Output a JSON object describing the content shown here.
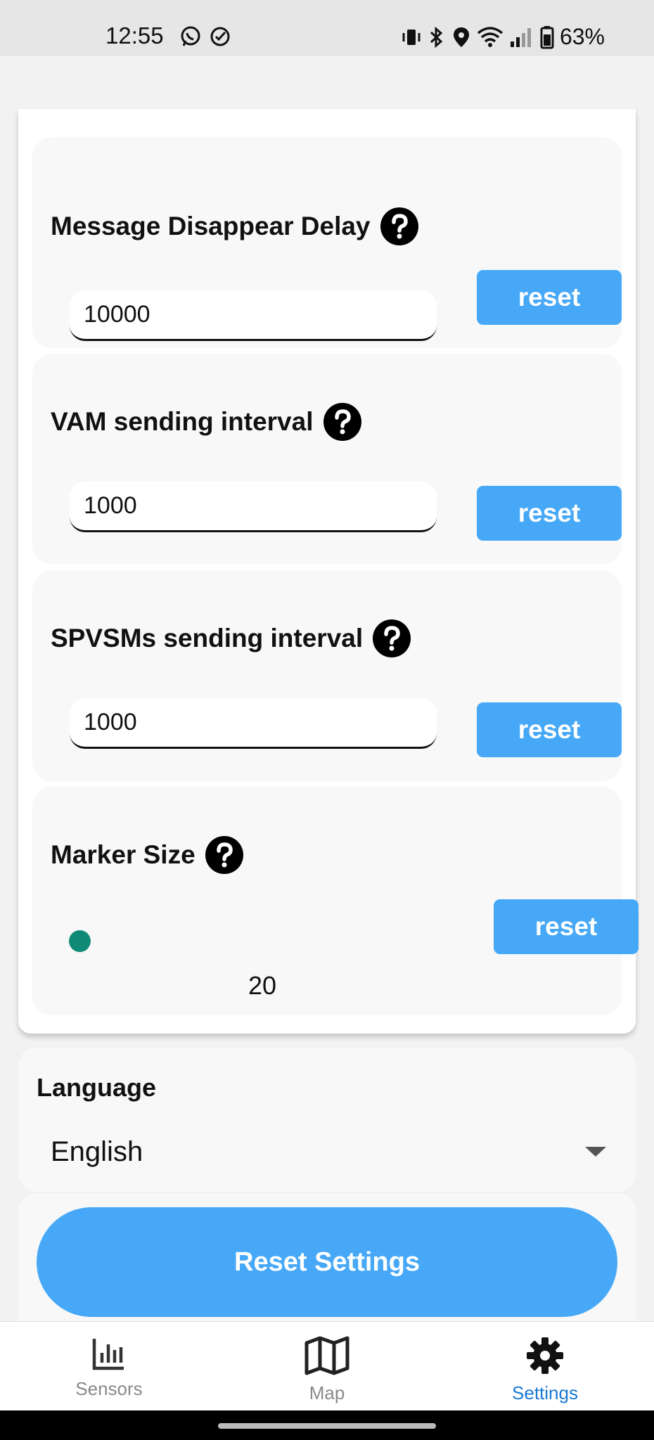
{
  "status_bar": {
    "time": "12:55",
    "battery": "63%",
    "icons": [
      "whatsapp-icon",
      "check-circle-icon",
      "vibrate-icon",
      "bluetooth-icon",
      "location-icon",
      "wifi-icon",
      "signal-icon",
      "battery-icon"
    ]
  },
  "settings": [
    {
      "label": "Message Disappear Delay",
      "value": "10000",
      "reset_label": "reset"
    },
    {
      "label": "VAM sending interval",
      "value": "1000",
      "reset_label": "reset"
    },
    {
      "label": "SPVSMs sending interval",
      "value": "1000",
      "reset_label": "reset"
    }
  ],
  "marker_size": {
    "label": "Marker Size",
    "value": "20",
    "reset_label": "reset",
    "thumb_color": "#0f8a76"
  },
  "language": {
    "title": "Language",
    "selected": "English"
  },
  "reset_settings_label": "Reset Settings",
  "bottom_nav": {
    "items": [
      {
        "label": "Sensors",
        "icon": "bar-chart-icon",
        "active": false
      },
      {
        "label": "Map",
        "icon": "map-icon",
        "active": false
      },
      {
        "label": "Settings",
        "icon": "gear-icon",
        "active": true
      }
    ],
    "active_color": "#1a78d2"
  },
  "colors": {
    "accent": "#46a8f7",
    "card_bg": "#f8f8f8"
  }
}
